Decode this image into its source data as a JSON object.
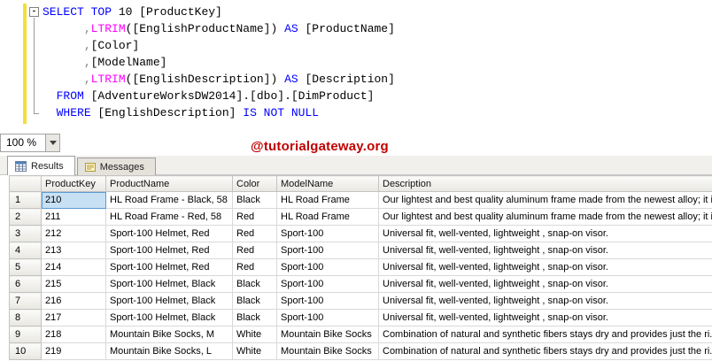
{
  "editor": {
    "collapse_glyph": "-",
    "token_colors": {
      "keyword": "#0000ff",
      "function": "#ff00ff",
      "operator": "#808080",
      "default": "#000000"
    },
    "lines": [
      {
        "tokens": [
          {
            "c": "k",
            "t": "SELECT"
          },
          {
            "c": "d",
            "t": " "
          },
          {
            "c": "k",
            "t": "TOP"
          },
          {
            "c": "d",
            "t": " 10 [ProductKey]"
          }
        ]
      },
      {
        "tokens": [
          {
            "c": "d",
            "t": "      "
          },
          {
            "c": "o",
            "t": ","
          },
          {
            "c": "f",
            "t": "LTRIM"
          },
          {
            "c": "d",
            "t": "([EnglishProductName]) "
          },
          {
            "c": "k",
            "t": "AS"
          },
          {
            "c": "d",
            "t": " [ProductName]"
          }
        ]
      },
      {
        "tokens": [
          {
            "c": "d",
            "t": "      "
          },
          {
            "c": "o",
            "t": ","
          },
          {
            "c": "d",
            "t": "[Color]"
          }
        ]
      },
      {
        "tokens": [
          {
            "c": "d",
            "t": "      "
          },
          {
            "c": "o",
            "t": ","
          },
          {
            "c": "d",
            "t": "[ModelName]"
          }
        ]
      },
      {
        "tokens": [
          {
            "c": "d",
            "t": "      "
          },
          {
            "c": "o",
            "t": ","
          },
          {
            "c": "f",
            "t": "LTRIM"
          },
          {
            "c": "d",
            "t": "([EnglishDescription]) "
          },
          {
            "c": "k",
            "t": "AS"
          },
          {
            "c": "d",
            "t": " [Description]"
          }
        ]
      },
      {
        "tokens": [
          {
            "c": "d",
            "t": "  "
          },
          {
            "c": "k",
            "t": "FROM"
          },
          {
            "c": "d",
            "t": " [AdventureWorksDW2014].[dbo].[DimProduct]"
          }
        ]
      },
      {
        "tokens": [
          {
            "c": "d",
            "t": "  "
          },
          {
            "c": "k",
            "t": "WHERE"
          },
          {
            "c": "d",
            "t": " [EnglishDescription] "
          },
          {
            "c": "k",
            "t": "IS NOT NULL"
          }
        ]
      }
    ]
  },
  "zoom": {
    "value": "100 %"
  },
  "watermark": "@tutorialgateway.org",
  "watermark_color": "#c00000",
  "tabs": {
    "results": "Results",
    "messages": "Messages",
    "results_icon": "grid-icon",
    "messages_icon": "note-icon"
  },
  "grid": {
    "columns": [
      "ProductKey",
      "ProductName",
      "Color",
      "ModelName",
      "Description"
    ],
    "selected": {
      "row": 0,
      "col": 0
    },
    "rows": [
      {
        "num": "1",
        "cells": [
          "210",
          "HL Road Frame - Black, 58",
          "Black",
          "HL Road Frame",
          "Our lightest and best quality aluminum frame made from the newest alloy; it i..."
        ]
      },
      {
        "num": "2",
        "cells": [
          "211",
          "HL Road Frame - Red, 58",
          "Red",
          "HL Road Frame",
          "Our lightest and best quality aluminum frame made from the newest alloy; it i..."
        ]
      },
      {
        "num": "3",
        "cells": [
          "212",
          "Sport-100 Helmet, Red",
          "Red",
          "Sport-100",
          "Universal fit, well-vented, lightweight , snap-on visor."
        ]
      },
      {
        "num": "4",
        "cells": [
          "213",
          "Sport-100 Helmet, Red",
          "Red",
          "Sport-100",
          "Universal fit, well-vented, lightweight , snap-on visor."
        ]
      },
      {
        "num": "5",
        "cells": [
          "214",
          "Sport-100 Helmet, Red",
          "Red",
          "Sport-100",
          "Universal fit, well-vented, lightweight , snap-on visor."
        ]
      },
      {
        "num": "6",
        "cells": [
          "215",
          "Sport-100 Helmet, Black",
          "Black",
          "Sport-100",
          "Universal fit, well-vented, lightweight , snap-on visor."
        ]
      },
      {
        "num": "7",
        "cells": [
          "216",
          "Sport-100 Helmet, Black",
          "Black",
          "Sport-100",
          "Universal fit, well-vented, lightweight , snap-on visor."
        ]
      },
      {
        "num": "8",
        "cells": [
          "217",
          "Sport-100 Helmet, Black",
          "Black",
          "Sport-100",
          "Universal fit, well-vented, lightweight , snap-on visor."
        ]
      },
      {
        "num": "9",
        "cells": [
          "218",
          "Mountain Bike Socks, M",
          "White",
          "Mountain Bike Socks",
          "Combination of natural and synthetic fibers stays dry and provides just the ri..."
        ]
      },
      {
        "num": "10",
        "cells": [
          "219",
          "Mountain Bike Socks, L",
          "White",
          "Mountain Bike Socks",
          "Combination of natural and synthetic fibers stays dry and provides just the ri..."
        ]
      }
    ]
  }
}
